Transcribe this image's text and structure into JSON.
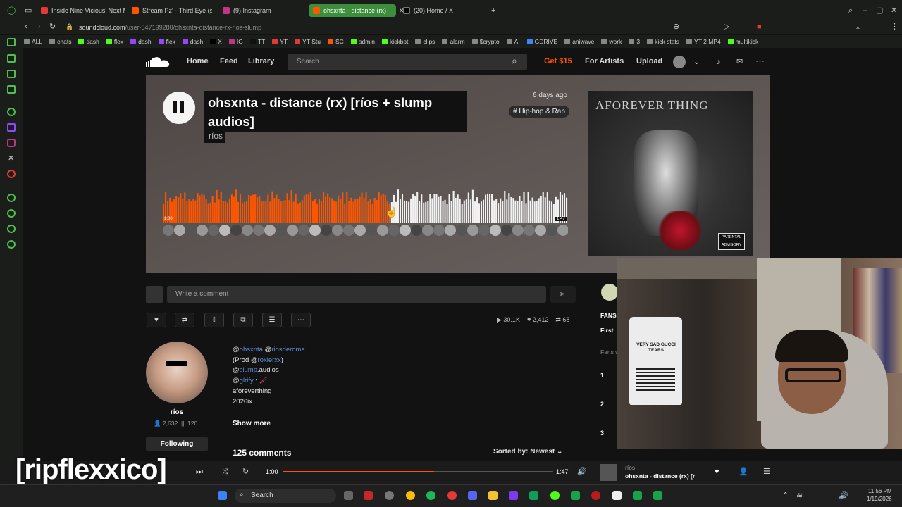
{
  "browser": {
    "tabs": [
      {
        "label": "Inside Nine Vicious' Next M"
      },
      {
        "label": "Stream Pz' - Third Eye (s"
      },
      {
        "label": "(9) Instagram"
      },
      {
        "label": "ohsxnta - distance (rx)"
      },
      {
        "label": "(20) Home / X"
      }
    ],
    "url_host": "soundcloud.com",
    "url_path": "/user-547199280/ohsxnta-distance-rx-rios-slump",
    "bookmarks": [
      "ALL",
      "chats",
      "dash",
      "flex",
      "dash",
      "flex",
      "dash",
      "X",
      "IG",
      "TT",
      "YT",
      "YT Stu",
      "SC",
      "admin",
      "kickbot",
      "clips",
      "alarm",
      "$crypto",
      "AI",
      "GDRIVE",
      "aniwave",
      "work",
      "3",
      "kick stats",
      "YT 2 MP4",
      "multikick"
    ]
  },
  "header": {
    "nav": [
      "Home",
      "Feed",
      "Library"
    ],
    "search_placeholder": "Search",
    "get": "Get $15",
    "for_artists": "For Artists",
    "upload": "Upload"
  },
  "track": {
    "title": "ohsxnta - distance (rx) [ríos + slump audios]",
    "artist": "ríos",
    "posted": "6 days ago",
    "genre": "# Hip-hop & Rap",
    "time_start": "1:00",
    "time_end": "1:47",
    "progress": 0.56,
    "cover_text": "AFOREVER THING",
    "advisory": "PARENTAL ADVISORY"
  },
  "comment": {
    "placeholder": "Write a comment"
  },
  "stats": {
    "plays": "30.1K",
    "likes": "2,412",
    "reposts": "68"
  },
  "profile": {
    "name": "ríos",
    "followers": "2,632",
    "tracks": "120",
    "follow_label": "Following"
  },
  "description": {
    "line1_a": "@",
    "line1_b": "ohsxnta",
    "line1_c": " @",
    "line1_d": "riosderoma",
    "line2_a": "(Prod @",
    "line2_b": "roxierxx",
    "line2_c": ")",
    "line3_a": "@",
    "line3_b": "slump",
    "line3_c": ".audios",
    "line4_a": "@",
    "line4_b": "glrify",
    "line4_c": " : ",
    "line5": "aforeverthing",
    "line6": "2026ix",
    "show_more": "Show more"
  },
  "comments": {
    "count": "125 comments",
    "sort": "Sorted by: Newest"
  },
  "sidebar": {
    "fans": "FANS",
    "first": "First",
    "fans_w": "Fans w",
    "ranks": [
      "1",
      "2",
      "3"
    ]
  },
  "webcam": {
    "shirt_text": "VERY SAD GUCCI TEARS"
  },
  "player": {
    "elapsed": "1:00",
    "total": "1:47",
    "progress": 0.56,
    "artist": "ríos",
    "title": "ohsxnta - distance (rx) [r"
  },
  "overlay": {
    "text": "[ripflexxico]"
  },
  "taskbar": {
    "search": "Search",
    "time": "11:56 PM",
    "date": "1/19/2026"
  },
  "colors": {
    "accent": "#ff5500",
    "waveform_played": "#ff5500",
    "waveform_unplayed": "#f2f2f2"
  }
}
